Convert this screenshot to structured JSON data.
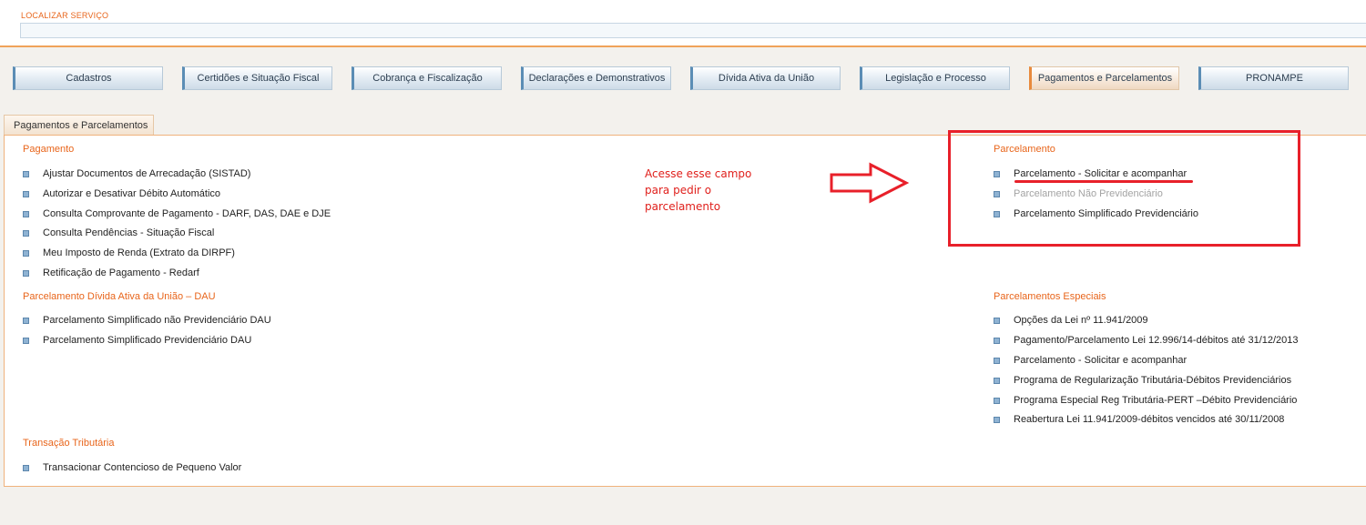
{
  "search": {
    "label": "LOCALIZAR SERVIÇO",
    "value": "",
    "placeholder": ""
  },
  "tabs": [
    {
      "label": "Cadastros"
    },
    {
      "label": "Certidões e Situação Fiscal"
    },
    {
      "label": "Cobrança e Fiscalização"
    },
    {
      "label": "Declarações e Demonstrativos"
    },
    {
      "label": "Dívida Ativa da União"
    },
    {
      "label": "Legislação e Processo"
    },
    {
      "label": "Pagamentos e Parcelamentos",
      "active": true
    },
    {
      "label": "PRONAMPE"
    }
  ],
  "section_tab": "Pagamentos e Parcelamentos",
  "groups": {
    "pagamento": {
      "title": "Pagamento",
      "items": [
        "Ajustar Documentos de Arrecadação (SISTAD)",
        "Autorizar e Desativar Débito Automático",
        "Consulta Comprovante de Pagamento - DARF, DAS, DAE e DJE",
        "Consulta Pendências - Situação Fiscal",
        "Meu Imposto de Renda (Extrato da DIRPF)",
        "Retificação de Pagamento - Redarf"
      ]
    },
    "dau": {
      "title": "Parcelamento Dívida Ativa da União – DAU",
      "items": [
        "Parcelamento Simplificado não Previdenciário DAU",
        "Parcelamento Simplificado Previdenciário DAU"
      ]
    },
    "transacao": {
      "title": "Transação Tributária",
      "items": [
        "Transacionar Contencioso de Pequeno Valor"
      ]
    },
    "parcelamento": {
      "title": "Parcelamento",
      "items": [
        "Parcelamento - Solicitar e acompanhar",
        "Parcelamento Não Previdenciário",
        "Parcelamento Simplificado Previdenciário"
      ]
    },
    "especiais": {
      "title": "Parcelamentos Especiais",
      "items": [
        "Opções da Lei nº 11.941/2009",
        "Pagamento/Parcelamento Lei 12.996/14-débitos até 31/12/2013",
        "Parcelamento - Solicitar e acompanhar",
        "Programa de Regularização Tributária-Débitos Previdenciários",
        "Programa Especial Reg Tributária-PERT –Débito Previdenciário",
        "Reabertura Lei 11.941/2009-débitos vencidos até 30/11/2008"
      ]
    }
  },
  "annotation": {
    "line1": "Acesse esse campo",
    "line2": "para pedir o",
    "line3": "parcelamento"
  },
  "colors": {
    "accent": "#e8651b",
    "annotation": "#e8202a",
    "tab_border": "#5b8db5"
  }
}
